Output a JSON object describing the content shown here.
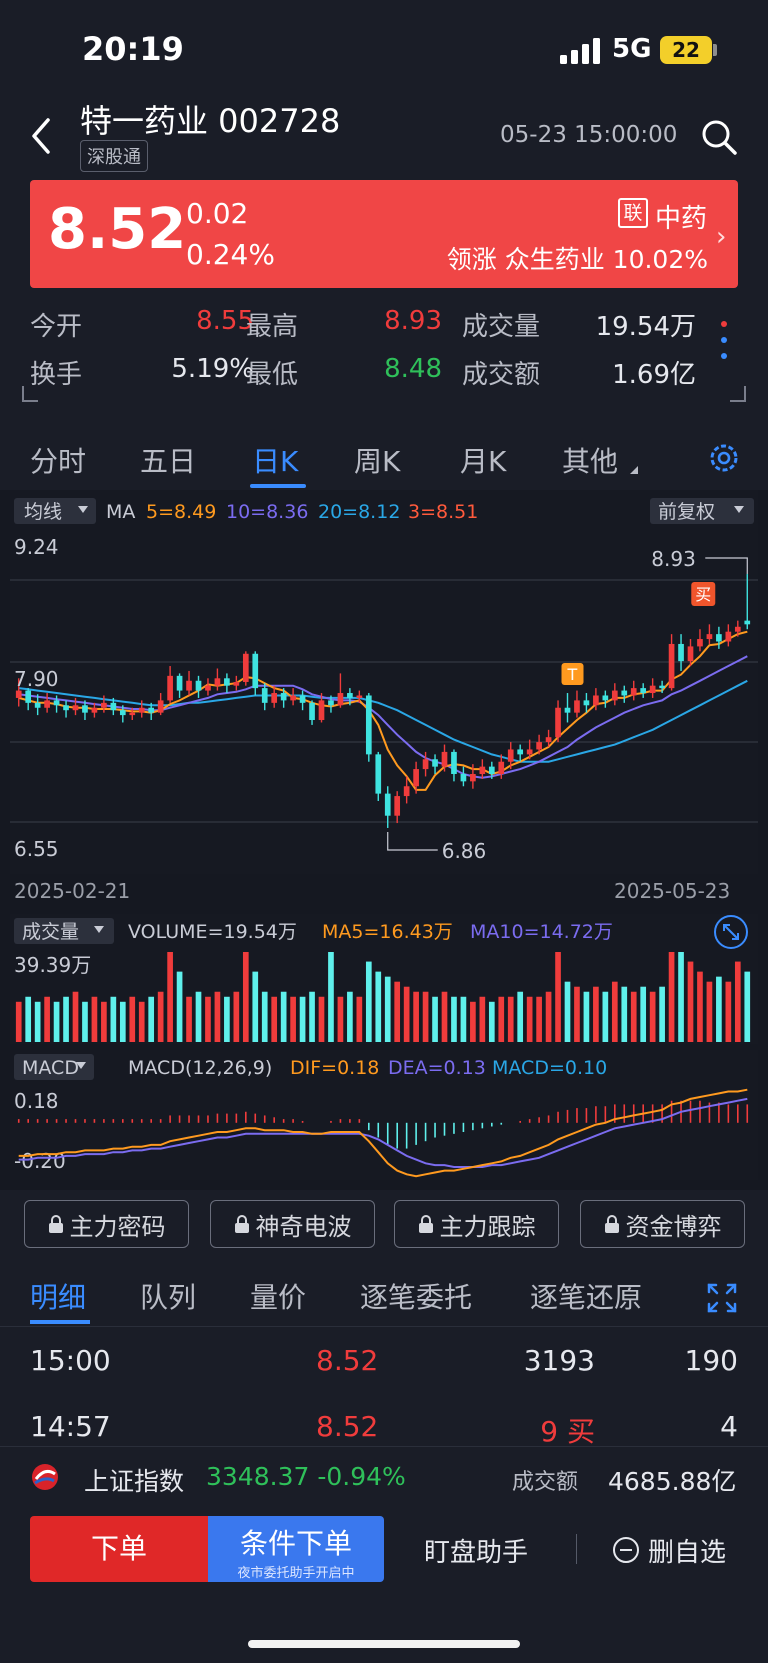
{
  "status_bar": {
    "time": "20:19",
    "network": "5G",
    "battery": "22"
  },
  "header": {
    "stock_name": "特一药业 002728",
    "tag": "深股通",
    "datetime": "05-23 15:00:00"
  },
  "quote": {
    "price": "8.52",
    "change": "0.02",
    "change_pct": "0.24%",
    "sector_badge": "联",
    "sector": "中药",
    "leader_text": "领涨 众生药业 10.02%",
    "colors": {
      "banner": "#f04646",
      "up": "#f03c3c",
      "down": "#2fc05a"
    }
  },
  "stats": [
    {
      "label": "今开",
      "value": "8.55",
      "color": "red"
    },
    {
      "label": "最高",
      "value": "8.93",
      "color": "red"
    },
    {
      "label": "成交量",
      "value": "19.54万",
      "color": "plain"
    },
    {
      "label": "换手",
      "value": "5.19%",
      "color": "plain"
    },
    {
      "label": "最低",
      "value": "8.48",
      "color": "green"
    },
    {
      "label": "成交额",
      "value": "1.69亿",
      "color": "plain"
    }
  ],
  "chart_tabs": [
    "分时",
    "五日",
    "日K",
    "周K",
    "月K",
    "其他"
  ],
  "chart_tab_active": "日K",
  "chart_data": {
    "type": "candlestick",
    "indicator_label": "均线",
    "ma_prefix": "MA",
    "ma": [
      {
        "label": "5=8.49",
        "color": "#ff9a1f"
      },
      {
        "label": "10=8.36",
        "color": "#7b6cf0"
      },
      {
        "label": "20=8.12",
        "color": "#2aa7e6"
      },
      {
        "label": "3=8.51",
        "color": "#ff5a3c"
      }
    ],
    "adjust": "前复权",
    "y_top_label": "9.24",
    "y_mid_label": "7.90",
    "y_bottom_label": "6.55",
    "ylim": [
      6.55,
      9.24
    ],
    "high_marker": "8.93",
    "low_marker": "6.86",
    "buy_marker": "买",
    "t_marker": "T",
    "x_start": "2025-02-21",
    "x_end": "2025-05-23",
    "candles": [
      [
        7.92,
        7.98,
        8.08,
        7.85
      ],
      [
        7.98,
        7.88,
        8.0,
        7.82
      ],
      [
        7.88,
        7.84,
        7.95,
        7.78
      ],
      [
        7.84,
        7.9,
        7.96,
        7.8
      ],
      [
        7.9,
        7.86,
        7.94,
        7.8
      ],
      [
        7.86,
        7.82,
        7.9,
        7.76
      ],
      [
        7.82,
        7.86,
        7.92,
        7.78
      ],
      [
        7.86,
        7.8,
        7.9,
        7.74
      ],
      [
        7.8,
        7.84,
        7.88,
        7.76
      ],
      [
        7.84,
        7.88,
        7.94,
        7.8
      ],
      [
        7.88,
        7.82,
        7.92,
        7.78
      ],
      [
        7.82,
        7.78,
        7.86,
        7.72
      ],
      [
        7.78,
        7.8,
        7.84,
        7.74
      ],
      [
        7.8,
        7.84,
        7.9,
        7.76
      ],
      [
        7.84,
        7.8,
        7.88,
        7.74
      ],
      [
        7.8,
        7.9,
        7.96,
        7.78
      ],
      [
        7.9,
        8.1,
        8.18,
        7.88
      ],
      [
        8.1,
        7.98,
        8.12,
        7.92
      ],
      [
        7.98,
        8.06,
        8.14,
        7.94
      ],
      [
        8.06,
        7.98,
        8.1,
        7.92
      ],
      [
        7.98,
        8.02,
        8.08,
        7.94
      ],
      [
        8.02,
        8.08,
        8.16,
        7.98
      ],
      [
        8.08,
        8.02,
        8.12,
        7.96
      ],
      [
        8.02,
        8.05,
        8.1,
        7.98
      ],
      [
        8.05,
        8.28,
        8.3,
        8.02
      ],
      [
        8.28,
        8.0,
        8.3,
        7.94
      ],
      [
        8.0,
        7.88,
        8.04,
        7.82
      ],
      [
        7.88,
        7.96,
        8.02,
        7.84
      ],
      [
        7.96,
        7.9,
        8.0,
        7.84
      ],
      [
        7.9,
        7.94,
        8.0,
        7.86
      ],
      [
        7.94,
        7.88,
        7.98,
        7.82
      ],
      [
        7.88,
        7.74,
        7.9,
        7.7
      ],
      [
        7.74,
        7.9,
        7.96,
        7.72
      ],
      [
        7.9,
        7.86,
        7.94,
        7.8
      ],
      [
        7.86,
        7.96,
        8.12,
        7.84
      ],
      [
        7.96,
        7.92,
        8.0,
        7.86
      ],
      [
        7.92,
        7.94,
        7.98,
        7.88
      ],
      [
        7.94,
        7.46,
        7.96,
        7.4
      ],
      [
        7.46,
        7.14,
        7.48,
        7.08
      ],
      [
        7.14,
        6.96,
        7.2,
        6.86
      ],
      [
        6.96,
        7.12,
        7.16,
        6.9
      ],
      [
        7.12,
        7.2,
        7.28,
        7.06
      ],
      [
        7.2,
        7.34,
        7.4,
        7.14
      ],
      [
        7.34,
        7.42,
        7.48,
        7.28
      ],
      [
        7.42,
        7.36,
        7.46,
        7.3
      ],
      [
        7.36,
        7.48,
        7.54,
        7.32
      ],
      [
        7.48,
        7.3,
        7.5,
        7.24
      ],
      [
        7.3,
        7.24,
        7.36,
        7.2
      ],
      [
        7.24,
        7.3,
        7.38,
        7.18
      ],
      [
        7.3,
        7.36,
        7.42,
        7.26
      ],
      [
        7.36,
        7.3,
        7.4,
        7.26
      ],
      [
        7.3,
        7.4,
        7.46,
        7.26
      ],
      [
        7.4,
        7.5,
        7.56,
        7.34
      ],
      [
        7.5,
        7.46,
        7.54,
        7.4
      ],
      [
        7.46,
        7.5,
        7.58,
        7.42
      ],
      [
        7.5,
        7.56,
        7.62,
        7.46
      ],
      [
        7.56,
        7.6,
        7.66,
        7.52
      ],
      [
        7.6,
        7.84,
        7.9,
        7.56
      ],
      [
        7.84,
        7.8,
        7.96,
        7.72
      ],
      [
        7.8,
        7.9,
        7.98,
        7.76
      ],
      [
        7.9,
        7.86,
        7.96,
        7.8
      ],
      [
        7.86,
        7.94,
        8.0,
        7.82
      ],
      [
        7.94,
        7.9,
        7.98,
        7.84
      ],
      [
        7.9,
        7.98,
        8.04,
        7.86
      ],
      [
        7.98,
        7.94,
        8.02,
        7.88
      ],
      [
        7.94,
        8.0,
        8.06,
        7.9
      ],
      [
        8.0,
        7.96,
        8.04,
        7.92
      ],
      [
        7.96,
        8.02,
        8.08,
        7.92
      ],
      [
        8.02,
        8.0,
        8.06,
        7.96
      ],
      [
        8.0,
        8.36,
        8.44,
        7.98
      ],
      [
        8.36,
        8.22,
        8.44,
        8.14
      ],
      [
        8.22,
        8.34,
        8.4,
        8.18
      ],
      [
        8.34,
        8.4,
        8.48,
        8.3
      ],
      [
        8.4,
        8.44,
        8.52,
        8.36
      ],
      [
        8.44,
        8.38,
        8.5,
        8.32
      ],
      [
        8.38,
        8.46,
        8.52,
        8.34
      ],
      [
        8.46,
        8.5,
        8.55,
        8.42
      ],
      [
        8.55,
        8.52,
        8.93,
        8.48
      ]
    ],
    "ma_series": {
      "ma5": [
        7.92,
        7.9,
        7.88,
        7.88,
        7.87,
        7.85,
        7.84,
        7.84,
        7.83,
        7.83,
        7.83,
        7.82,
        7.81,
        7.81,
        7.8,
        7.82,
        7.87,
        7.9,
        7.94,
        7.98,
        8.03,
        8.02,
        8.03,
        8.04,
        8.09,
        8.08,
        8.04,
        8.0,
        7.98,
        7.92,
        7.91,
        7.88,
        7.86,
        7.85,
        7.87,
        7.88,
        7.9,
        7.82,
        7.7,
        7.5,
        7.37,
        7.28,
        7.17,
        7.17,
        7.29,
        7.36,
        7.38,
        7.37,
        7.34,
        7.34,
        7.3,
        7.32,
        7.37,
        7.4,
        7.44,
        7.48,
        7.52,
        7.6,
        7.67,
        7.74,
        7.8,
        7.87,
        7.88,
        7.92,
        7.92,
        7.95,
        7.96,
        7.98,
        7.98,
        8.07,
        8.11,
        8.19,
        8.26,
        8.35,
        8.36,
        8.4,
        8.44,
        8.46
      ],
      "ma10": [
        7.95,
        7.94,
        7.93,
        7.92,
        7.91,
        7.9,
        7.89,
        7.88,
        7.87,
        7.86,
        7.85,
        7.84,
        7.83,
        7.83,
        7.82,
        7.82,
        7.84,
        7.86,
        7.88,
        7.9,
        7.92,
        7.95,
        7.96,
        7.97,
        7.99,
        8.02,
        8.02,
        8.02,
        8.02,
        8.02,
        7.99,
        7.95,
        7.93,
        7.91,
        7.9,
        7.9,
        7.89,
        7.84,
        7.78,
        7.7,
        7.62,
        7.55,
        7.48,
        7.43,
        7.4,
        7.38,
        7.34,
        7.3,
        7.28,
        7.27,
        7.28,
        7.3,
        7.32,
        7.34,
        7.37,
        7.4,
        7.44,
        7.48,
        7.52,
        7.58,
        7.63,
        7.68,
        7.72,
        7.76,
        7.8,
        7.83,
        7.86,
        7.88,
        7.9,
        7.95,
        7.98,
        8.02,
        8.06,
        8.1,
        8.14,
        8.18,
        8.22,
        8.26
      ],
      "ma20": [
        8.0,
        7.99,
        7.98,
        7.97,
        7.96,
        7.95,
        7.94,
        7.93,
        7.92,
        7.91,
        7.9,
        7.89,
        7.88,
        7.87,
        7.86,
        7.86,
        7.86,
        7.87,
        7.88,
        7.88,
        7.89,
        7.9,
        7.91,
        7.92,
        7.93,
        7.94,
        7.94,
        7.94,
        7.94,
        7.94,
        7.94,
        7.93,
        7.92,
        7.92,
        7.92,
        7.92,
        7.92,
        7.9,
        7.88,
        7.85,
        7.82,
        7.78,
        7.74,
        7.7,
        7.66,
        7.62,
        7.58,
        7.55,
        7.52,
        7.49,
        7.46,
        7.44,
        7.42,
        7.4,
        7.4,
        7.4,
        7.4,
        7.42,
        7.44,
        7.46,
        7.48,
        7.5,
        7.52,
        7.54,
        7.57,
        7.6,
        7.63,
        7.66,
        7.7,
        7.74,
        7.78,
        7.82,
        7.86,
        7.9,
        7.94,
        7.98,
        8.02,
        8.06
      ]
    },
    "volume": {
      "label": "成交量",
      "vol_text": "VOLUME=19.54万",
      "ma5_text": "MA5=16.43万",
      "ma10_text": "MA10=14.72万",
      "y_top_label": "39.39万",
      "values": [
        8,
        9,
        8,
        9,
        8,
        9,
        10,
        8,
        9,
        8,
        9,
        8,
        9,
        8,
        9,
        10,
        18,
        14,
        9,
        10,
        9,
        10,
        9,
        10,
        22,
        14,
        10,
        9,
        10,
        9,
        9,
        10,
        9,
        18,
        9,
        10,
        9,
        16,
        14,
        13,
        12,
        11,
        10,
        10,
        9,
        10,
        9,
        9,
        8,
        9,
        8,
        9,
        9,
        10,
        9,
        9,
        10,
        18,
        12,
        11,
        10,
        11,
        10,
        12,
        11,
        10,
        11,
        10,
        11,
        32,
        20,
        16,
        14,
        12,
        13,
        12,
        16,
        14
      ],
      "ylim": [
        0,
        39.39
      ]
    },
    "macd": {
      "label": "MACD",
      "params": "MACD(12,26,9)",
      "dif_text": "DIF=0.18",
      "dea_text": "DEA=0.13",
      "macd_text": "MACD=0.10",
      "y_top_label": "0.18",
      "y_bottom_label": "-0.20",
      "hist": [
        0.02,
        0.02,
        0.02,
        0.02,
        0.02,
        0.02,
        0.02,
        0.02,
        0.02,
        0.02,
        0.02,
        0.02,
        0.02,
        0.02,
        0.02,
        0.02,
        0.04,
        0.04,
        0.04,
        0.04,
        0.04,
        0.05,
        0.05,
        0.05,
        0.06,
        0.05,
        0.04,
        0.03,
        0.02,
        0.02,
        0.01,
        0.0,
        0.0,
        0.01,
        0.02,
        0.02,
        0.02,
        -0.04,
        -0.08,
        -0.12,
        -0.14,
        -0.14,
        -0.12,
        -0.1,
        -0.08,
        -0.07,
        -0.06,
        -0.05,
        -0.04,
        -0.03,
        -0.02,
        -0.01,
        0.0,
        0.01,
        0.02,
        0.03,
        0.04,
        0.06,
        0.07,
        0.08,
        0.08,
        0.09,
        0.09,
        0.1,
        0.1,
        0.1,
        0.1,
        0.1,
        0.1,
        0.12,
        0.12,
        0.12,
        0.12,
        0.11,
        0.11,
        0.1,
        0.1,
        0.1
      ],
      "dif": [
        -0.18,
        -0.18,
        -0.17,
        -0.17,
        -0.17,
        -0.16,
        -0.16,
        -0.15,
        -0.15,
        -0.15,
        -0.14,
        -0.14,
        -0.13,
        -0.13,
        -0.12,
        -0.12,
        -0.1,
        -0.09,
        -0.08,
        -0.07,
        -0.06,
        -0.05,
        -0.05,
        -0.04,
        -0.03,
        -0.03,
        -0.04,
        -0.04,
        -0.04,
        -0.05,
        -0.05,
        -0.06,
        -0.06,
        -0.05,
        -0.05,
        -0.05,
        -0.05,
        -0.1,
        -0.16,
        -0.22,
        -0.26,
        -0.28,
        -0.29,
        -0.28,
        -0.27,
        -0.26,
        -0.26,
        -0.25,
        -0.24,
        -0.23,
        -0.22,
        -0.21,
        -0.19,
        -0.18,
        -0.16,
        -0.14,
        -0.12,
        -0.09,
        -0.07,
        -0.05,
        -0.03,
        -0.01,
        0.0,
        0.02,
        0.03,
        0.04,
        0.05,
        0.06,
        0.07,
        0.1,
        0.11,
        0.13,
        0.14,
        0.15,
        0.16,
        0.17,
        0.17,
        0.18
      ],
      "dea": [
        -0.2,
        -0.2,
        -0.19,
        -0.19,
        -0.19,
        -0.18,
        -0.18,
        -0.17,
        -0.17,
        -0.17,
        -0.16,
        -0.16,
        -0.15,
        -0.15,
        -0.14,
        -0.14,
        -0.13,
        -0.12,
        -0.11,
        -0.1,
        -0.09,
        -0.08,
        -0.08,
        -0.07,
        -0.06,
        -0.06,
        -0.06,
        -0.06,
        -0.06,
        -0.06,
        -0.06,
        -0.06,
        -0.06,
        -0.06,
        -0.06,
        -0.06,
        -0.06,
        -0.07,
        -0.09,
        -0.12,
        -0.15,
        -0.18,
        -0.2,
        -0.22,
        -0.23,
        -0.23,
        -0.24,
        -0.24,
        -0.24,
        -0.24,
        -0.23,
        -0.23,
        -0.22,
        -0.21,
        -0.2,
        -0.19,
        -0.17,
        -0.15,
        -0.13,
        -0.11,
        -0.09,
        -0.07,
        -0.05,
        -0.03,
        -0.02,
        -0.01,
        0.0,
        0.01,
        0.02,
        0.04,
        0.06,
        0.07,
        0.08,
        0.09,
        0.1,
        0.11,
        0.12,
        0.13
      ],
      "ylim": [
        -0.3,
        0.2
      ]
    }
  },
  "feature_buttons": [
    "主力密码",
    "神奇电波",
    "主力跟踪",
    "资金博弈"
  ],
  "detail_tabs": [
    "明细",
    "队列",
    "量价",
    "逐笔委托",
    "逐笔还原"
  ],
  "detail_tab_active": "明细",
  "trades": [
    {
      "time": "15:00",
      "price": "8.52",
      "vol": "3193",
      "count": "190"
    },
    {
      "time": "14:57",
      "price": "8.52",
      "vol": "9 买",
      "count": "4"
    }
  ],
  "index_bar": {
    "name": "上证指数",
    "value": "3348.37 -0.94%",
    "amount_label": "成交额",
    "amount": "4685.88亿"
  },
  "bottom_bar": {
    "order": "下单",
    "conditional": "条件下单",
    "conditional_sub": "夜市委托助手开启中",
    "watch": "盯盘助手",
    "remove": "删自选"
  }
}
